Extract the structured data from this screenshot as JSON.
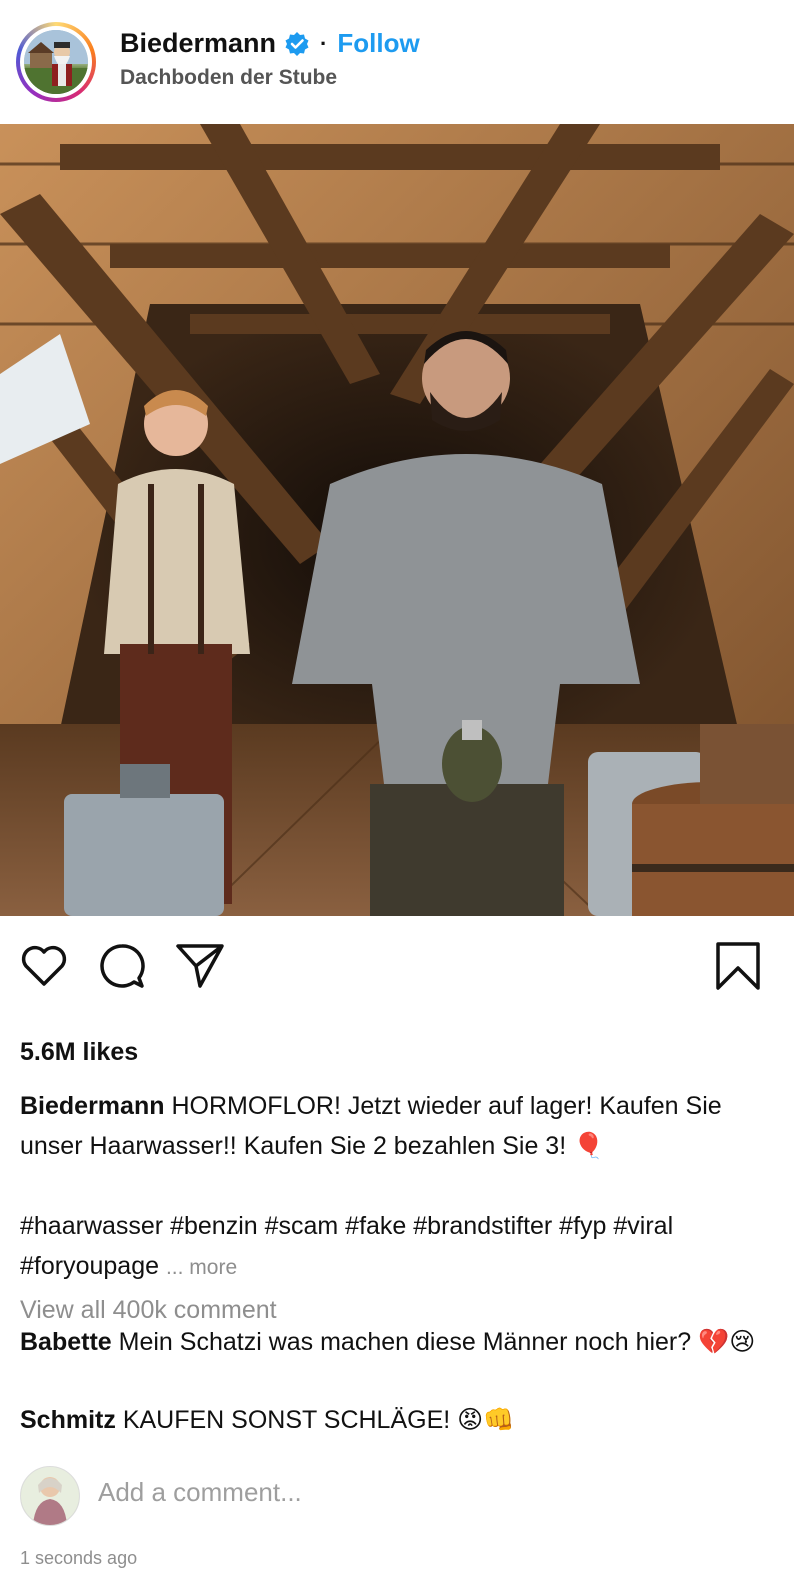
{
  "post": {
    "username": "Biedermann",
    "follow_label": "Follow",
    "separator": "·",
    "location": "Dachboden der Stube"
  },
  "stats": {
    "likes": "5.6M likes"
  },
  "caption": {
    "username": "Biedermann",
    "text": "HORMOFLOR! Jetzt wieder auf lager! Kaufen Sie unser Haarwasser!! Kaufen Sie 2 bezahlen Sie 3! 🎈",
    "hashtags": "#haarwasser #benzin #scam #fake #brandstifter #fyp #viral #foryoupage",
    "more_label": "... more"
  },
  "comments": {
    "view_all": "View all 400k comment",
    "items": [
      {
        "user": "Babette",
        "text": "Mein Schatzi was machen diese Männer noch hier? 💔😢"
      },
      {
        "user": "Schmitz",
        "text": "KAUFEN SONST SCHLÄGE! 😡👊"
      }
    ]
  },
  "composer": {
    "placeholder": "Add a comment..."
  },
  "meta": {
    "timestamp": "1 seconds ago"
  },
  "icons": {
    "like": "heart-icon",
    "comment": "comment-bubble-icon",
    "share": "paper-plane-icon",
    "save": "bookmark-icon",
    "verified": "verified-badge-icon"
  },
  "colors": {
    "follow": "#1d9bf0",
    "muted": "#8e8e8e",
    "verified": "#1d9bf0"
  }
}
